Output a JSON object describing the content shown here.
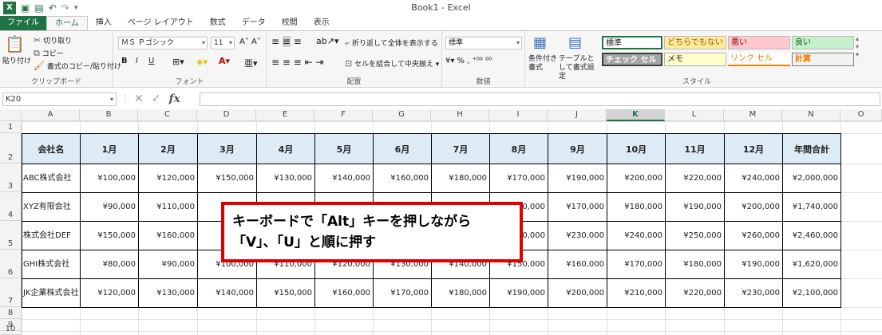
{
  "window": {
    "title": "Book1 - Excel"
  },
  "tabs": [
    "ファイル",
    "ホーム",
    "挿入",
    "ページ レイアウト",
    "数式",
    "データ",
    "校閲",
    "表示"
  ],
  "ribbon": {
    "clipboard": {
      "paste": "貼り付け",
      "cut": "切り取り",
      "copy": "コピー",
      "format_painter": "書式のコピー/貼り付け",
      "label": "クリップボード"
    },
    "font": {
      "name": "ＭＳ Ｐゴシック",
      "size": "11",
      "label": "フォント",
      "bold": "B",
      "italic": "I",
      "underline": "U"
    },
    "alignment": {
      "wrap": "折り返して全体を表示する",
      "merge": "セルを結合して中央揃え",
      "label": "配置"
    },
    "number": {
      "format": "標準",
      "label": "数値"
    },
    "styles": {
      "conditional": "条件付き書式",
      "table": "テーブルとして書式設定",
      "label": "スタイル",
      "cells": [
        "標準",
        "どちらでもない",
        "悪い",
        "良い",
        "チェック セル",
        "メモ",
        "リンク セル",
        "計算"
      ]
    }
  },
  "formula_bar": {
    "name_box": "K20",
    "fx": "fx"
  },
  "columns": [
    "A",
    "B",
    "C",
    "D",
    "E",
    "F",
    "G",
    "H",
    "I",
    "J",
    "K",
    "L",
    "M",
    "N",
    "O"
  ],
  "rows": [
    "1",
    "2",
    "3",
    "4",
    "5",
    "6",
    "7",
    "8",
    "9",
    "10"
  ],
  "table": {
    "headers": [
      "会社名",
      "1月",
      "2月",
      "3月",
      "4月",
      "5月",
      "6月",
      "7月",
      "8月",
      "9月",
      "10月",
      "11月",
      "12月",
      "年間合計"
    ],
    "rows": [
      [
        "ABC株式会社",
        "¥100,000",
        "¥120,000",
        "¥150,000",
        "¥130,000",
        "¥140,000",
        "¥160,000",
        "¥180,000",
        "¥170,000",
        "¥190,000",
        "¥200,000",
        "¥220,000",
        "¥240,000",
        "¥2,000,000"
      ],
      [
        "XYZ有限会社",
        "¥90,000",
        "¥110,000",
        "",
        "",
        "",
        "",
        "",
        "¥160,000",
        "¥170,000",
        "¥180,000",
        "¥190,000",
        "¥200,000",
        "¥1,740,000"
      ],
      [
        "株式会社DEF",
        "¥150,000",
        "¥160,000",
        "",
        "",
        "",
        "",
        "",
        "¥220,000",
        "¥230,000",
        "¥240,000",
        "¥250,000",
        "¥260,000",
        "¥2,460,000"
      ],
      [
        "GHI株式会社",
        "¥80,000",
        "¥90,000",
        "¥100,000",
        "¥110,000",
        "¥120,000",
        "¥130,000",
        "¥140,000",
        "¥150,000",
        "¥160,000",
        "¥170,000",
        "¥180,000",
        "¥190,000",
        "¥1,620,000"
      ],
      [
        "JK企業株式会社",
        "¥120,000",
        "¥130,000",
        "¥140,000",
        "¥150,000",
        "¥160,000",
        "¥170,000",
        "¥180,000",
        "¥190,000",
        "¥200,000",
        "¥210,000",
        "¥220,000",
        "¥230,000",
        "¥2,100,000"
      ]
    ]
  },
  "callout": {
    "line1": "キーボードで「Alt」キーを押しながら",
    "line2": "「V」、「U」と順に押す"
  },
  "colors": {
    "accent": "#217346",
    "header_fill": "#ddebf7",
    "callout_border": "#e00000"
  }
}
